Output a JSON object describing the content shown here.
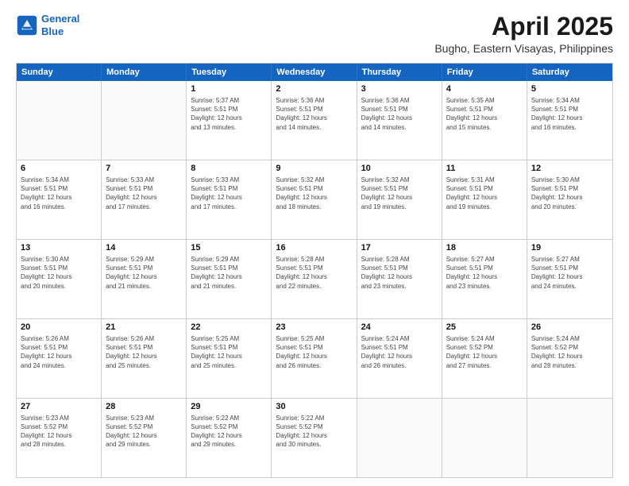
{
  "header": {
    "logo_line1": "General",
    "logo_line2": "Blue",
    "title": "April 2025",
    "subtitle": "Bugho, Eastern Visayas, Philippines"
  },
  "calendar": {
    "days_of_week": [
      "Sunday",
      "Monday",
      "Tuesday",
      "Wednesday",
      "Thursday",
      "Friday",
      "Saturday"
    ],
    "weeks": [
      [
        {
          "day": "",
          "info": ""
        },
        {
          "day": "",
          "info": ""
        },
        {
          "day": "1",
          "info": "Sunrise: 5:37 AM\nSunset: 5:51 PM\nDaylight: 12 hours\nand 13 minutes."
        },
        {
          "day": "2",
          "info": "Sunrise: 5:36 AM\nSunset: 5:51 PM\nDaylight: 12 hours\nand 14 minutes."
        },
        {
          "day": "3",
          "info": "Sunrise: 5:36 AM\nSunset: 5:51 PM\nDaylight: 12 hours\nand 14 minutes."
        },
        {
          "day": "4",
          "info": "Sunrise: 5:35 AM\nSunset: 5:51 PM\nDaylight: 12 hours\nand 15 minutes."
        },
        {
          "day": "5",
          "info": "Sunrise: 5:34 AM\nSunset: 5:51 PM\nDaylight: 12 hours\nand 16 minutes."
        }
      ],
      [
        {
          "day": "6",
          "info": "Sunrise: 5:34 AM\nSunset: 5:51 PM\nDaylight: 12 hours\nand 16 minutes."
        },
        {
          "day": "7",
          "info": "Sunrise: 5:33 AM\nSunset: 5:51 PM\nDaylight: 12 hours\nand 17 minutes."
        },
        {
          "day": "8",
          "info": "Sunrise: 5:33 AM\nSunset: 5:51 PM\nDaylight: 12 hours\nand 17 minutes."
        },
        {
          "day": "9",
          "info": "Sunrise: 5:32 AM\nSunset: 5:51 PM\nDaylight: 12 hours\nand 18 minutes."
        },
        {
          "day": "10",
          "info": "Sunrise: 5:32 AM\nSunset: 5:51 PM\nDaylight: 12 hours\nand 19 minutes."
        },
        {
          "day": "11",
          "info": "Sunrise: 5:31 AM\nSunset: 5:51 PM\nDaylight: 12 hours\nand 19 minutes."
        },
        {
          "day": "12",
          "info": "Sunrise: 5:30 AM\nSunset: 5:51 PM\nDaylight: 12 hours\nand 20 minutes."
        }
      ],
      [
        {
          "day": "13",
          "info": "Sunrise: 5:30 AM\nSunset: 5:51 PM\nDaylight: 12 hours\nand 20 minutes."
        },
        {
          "day": "14",
          "info": "Sunrise: 5:29 AM\nSunset: 5:51 PM\nDaylight: 12 hours\nand 21 minutes."
        },
        {
          "day": "15",
          "info": "Sunrise: 5:29 AM\nSunset: 5:51 PM\nDaylight: 12 hours\nand 21 minutes."
        },
        {
          "day": "16",
          "info": "Sunrise: 5:28 AM\nSunset: 5:51 PM\nDaylight: 12 hours\nand 22 minutes."
        },
        {
          "day": "17",
          "info": "Sunrise: 5:28 AM\nSunset: 5:51 PM\nDaylight: 12 hours\nand 23 minutes."
        },
        {
          "day": "18",
          "info": "Sunrise: 5:27 AM\nSunset: 5:51 PM\nDaylight: 12 hours\nand 23 minutes."
        },
        {
          "day": "19",
          "info": "Sunrise: 5:27 AM\nSunset: 5:51 PM\nDaylight: 12 hours\nand 24 minutes."
        }
      ],
      [
        {
          "day": "20",
          "info": "Sunrise: 5:26 AM\nSunset: 5:51 PM\nDaylight: 12 hours\nand 24 minutes."
        },
        {
          "day": "21",
          "info": "Sunrise: 5:26 AM\nSunset: 5:51 PM\nDaylight: 12 hours\nand 25 minutes."
        },
        {
          "day": "22",
          "info": "Sunrise: 5:25 AM\nSunset: 5:51 PM\nDaylight: 12 hours\nand 25 minutes."
        },
        {
          "day": "23",
          "info": "Sunrise: 5:25 AM\nSunset: 5:51 PM\nDaylight: 12 hours\nand 26 minutes."
        },
        {
          "day": "24",
          "info": "Sunrise: 5:24 AM\nSunset: 5:51 PM\nDaylight: 12 hours\nand 26 minutes."
        },
        {
          "day": "25",
          "info": "Sunrise: 5:24 AM\nSunset: 5:52 PM\nDaylight: 12 hours\nand 27 minutes."
        },
        {
          "day": "26",
          "info": "Sunrise: 5:24 AM\nSunset: 5:52 PM\nDaylight: 12 hours\nand 28 minutes."
        }
      ],
      [
        {
          "day": "27",
          "info": "Sunrise: 5:23 AM\nSunset: 5:52 PM\nDaylight: 12 hours\nand 28 minutes."
        },
        {
          "day": "28",
          "info": "Sunrise: 5:23 AM\nSunset: 5:52 PM\nDaylight: 12 hours\nand 29 minutes."
        },
        {
          "day": "29",
          "info": "Sunrise: 5:22 AM\nSunset: 5:52 PM\nDaylight: 12 hours\nand 29 minutes."
        },
        {
          "day": "30",
          "info": "Sunrise: 5:22 AM\nSunset: 5:52 PM\nDaylight: 12 hours\nand 30 minutes."
        },
        {
          "day": "",
          "info": ""
        },
        {
          "day": "",
          "info": ""
        },
        {
          "day": "",
          "info": ""
        }
      ]
    ]
  }
}
